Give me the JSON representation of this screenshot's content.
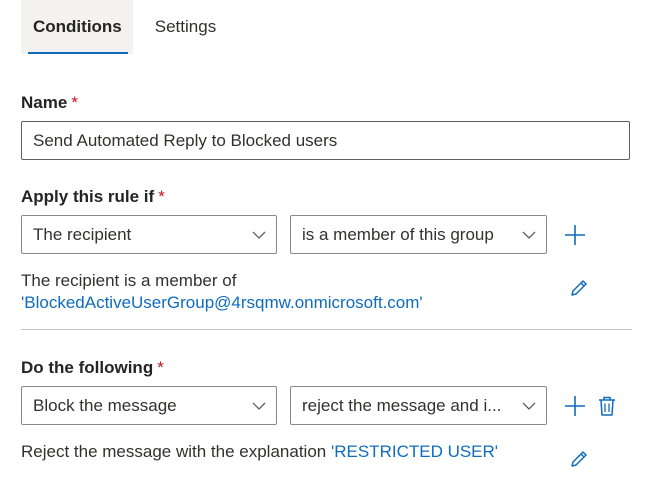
{
  "tabs": [
    {
      "label": "Conditions",
      "active": true
    },
    {
      "label": "Settings",
      "active": false
    }
  ],
  "name_field": {
    "label": "Name",
    "required_marker": "*",
    "value": "Send Automated Reply to Blocked users"
  },
  "apply_rule": {
    "label": "Apply this rule if",
    "required_marker": "*",
    "condition_dropdown": "The recipient",
    "operator_dropdown": "is a member of this group",
    "summary_text": "The recipient is a member of",
    "summary_link": "'BlockedActiveUserGroup@4rsqmw.onmicrosoft.com'"
  },
  "do_following": {
    "label": "Do the following",
    "required_marker": "*",
    "action_dropdown": "Block the message",
    "detail_dropdown": "reject the message and i...",
    "summary_text": "Reject the message with the explanation",
    "summary_link": "'RESTRICTED USER'"
  },
  "icons": {
    "add": "add-icon",
    "delete": "trash-icon",
    "edit": "pencil-icon",
    "dropdown": "chevron-down-icon"
  },
  "colors": {
    "accent": "#0f6cbd",
    "required": "#c50f1f"
  }
}
